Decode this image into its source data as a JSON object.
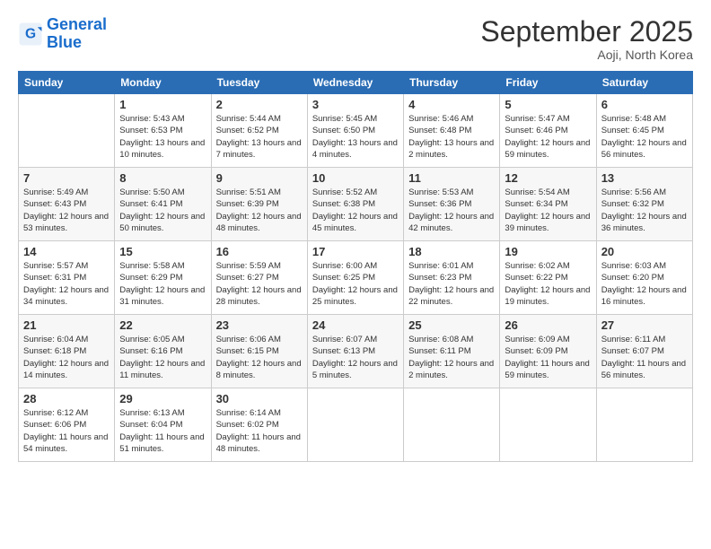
{
  "header": {
    "logo_line1": "General",
    "logo_line2": "Blue",
    "month": "September 2025",
    "location": "Aoji, North Korea"
  },
  "days_of_week": [
    "Sunday",
    "Monday",
    "Tuesday",
    "Wednesday",
    "Thursday",
    "Friday",
    "Saturday"
  ],
  "weeks": [
    [
      {
        "day": "",
        "sunrise": "",
        "sunset": "",
        "daylight": ""
      },
      {
        "day": "1",
        "sunrise": "Sunrise: 5:43 AM",
        "sunset": "Sunset: 6:53 PM",
        "daylight": "Daylight: 13 hours and 10 minutes."
      },
      {
        "day": "2",
        "sunrise": "Sunrise: 5:44 AM",
        "sunset": "Sunset: 6:52 PM",
        "daylight": "Daylight: 13 hours and 7 minutes."
      },
      {
        "day": "3",
        "sunrise": "Sunrise: 5:45 AM",
        "sunset": "Sunset: 6:50 PM",
        "daylight": "Daylight: 13 hours and 4 minutes."
      },
      {
        "day": "4",
        "sunrise": "Sunrise: 5:46 AM",
        "sunset": "Sunset: 6:48 PM",
        "daylight": "Daylight: 13 hours and 2 minutes."
      },
      {
        "day": "5",
        "sunrise": "Sunrise: 5:47 AM",
        "sunset": "Sunset: 6:46 PM",
        "daylight": "Daylight: 12 hours and 59 minutes."
      },
      {
        "day": "6",
        "sunrise": "Sunrise: 5:48 AM",
        "sunset": "Sunset: 6:45 PM",
        "daylight": "Daylight: 12 hours and 56 minutes."
      }
    ],
    [
      {
        "day": "7",
        "sunrise": "Sunrise: 5:49 AM",
        "sunset": "Sunset: 6:43 PM",
        "daylight": "Daylight: 12 hours and 53 minutes."
      },
      {
        "day": "8",
        "sunrise": "Sunrise: 5:50 AM",
        "sunset": "Sunset: 6:41 PM",
        "daylight": "Daylight: 12 hours and 50 minutes."
      },
      {
        "day": "9",
        "sunrise": "Sunrise: 5:51 AM",
        "sunset": "Sunset: 6:39 PM",
        "daylight": "Daylight: 12 hours and 48 minutes."
      },
      {
        "day": "10",
        "sunrise": "Sunrise: 5:52 AM",
        "sunset": "Sunset: 6:38 PM",
        "daylight": "Daylight: 12 hours and 45 minutes."
      },
      {
        "day": "11",
        "sunrise": "Sunrise: 5:53 AM",
        "sunset": "Sunset: 6:36 PM",
        "daylight": "Daylight: 12 hours and 42 minutes."
      },
      {
        "day": "12",
        "sunrise": "Sunrise: 5:54 AM",
        "sunset": "Sunset: 6:34 PM",
        "daylight": "Daylight: 12 hours and 39 minutes."
      },
      {
        "day": "13",
        "sunrise": "Sunrise: 5:56 AM",
        "sunset": "Sunset: 6:32 PM",
        "daylight": "Daylight: 12 hours and 36 minutes."
      }
    ],
    [
      {
        "day": "14",
        "sunrise": "Sunrise: 5:57 AM",
        "sunset": "Sunset: 6:31 PM",
        "daylight": "Daylight: 12 hours and 34 minutes."
      },
      {
        "day": "15",
        "sunrise": "Sunrise: 5:58 AM",
        "sunset": "Sunset: 6:29 PM",
        "daylight": "Daylight: 12 hours and 31 minutes."
      },
      {
        "day": "16",
        "sunrise": "Sunrise: 5:59 AM",
        "sunset": "Sunset: 6:27 PM",
        "daylight": "Daylight: 12 hours and 28 minutes."
      },
      {
        "day": "17",
        "sunrise": "Sunrise: 6:00 AM",
        "sunset": "Sunset: 6:25 PM",
        "daylight": "Daylight: 12 hours and 25 minutes."
      },
      {
        "day": "18",
        "sunrise": "Sunrise: 6:01 AM",
        "sunset": "Sunset: 6:23 PM",
        "daylight": "Daylight: 12 hours and 22 minutes."
      },
      {
        "day": "19",
        "sunrise": "Sunrise: 6:02 AM",
        "sunset": "Sunset: 6:22 PM",
        "daylight": "Daylight: 12 hours and 19 minutes."
      },
      {
        "day": "20",
        "sunrise": "Sunrise: 6:03 AM",
        "sunset": "Sunset: 6:20 PM",
        "daylight": "Daylight: 12 hours and 16 minutes."
      }
    ],
    [
      {
        "day": "21",
        "sunrise": "Sunrise: 6:04 AM",
        "sunset": "Sunset: 6:18 PM",
        "daylight": "Daylight: 12 hours and 14 minutes."
      },
      {
        "day": "22",
        "sunrise": "Sunrise: 6:05 AM",
        "sunset": "Sunset: 6:16 PM",
        "daylight": "Daylight: 12 hours and 11 minutes."
      },
      {
        "day": "23",
        "sunrise": "Sunrise: 6:06 AM",
        "sunset": "Sunset: 6:15 PM",
        "daylight": "Daylight: 12 hours and 8 minutes."
      },
      {
        "day": "24",
        "sunrise": "Sunrise: 6:07 AM",
        "sunset": "Sunset: 6:13 PM",
        "daylight": "Daylight: 12 hours and 5 minutes."
      },
      {
        "day": "25",
        "sunrise": "Sunrise: 6:08 AM",
        "sunset": "Sunset: 6:11 PM",
        "daylight": "Daylight: 12 hours and 2 minutes."
      },
      {
        "day": "26",
        "sunrise": "Sunrise: 6:09 AM",
        "sunset": "Sunset: 6:09 PM",
        "daylight": "Daylight: 11 hours and 59 minutes."
      },
      {
        "day": "27",
        "sunrise": "Sunrise: 6:11 AM",
        "sunset": "Sunset: 6:07 PM",
        "daylight": "Daylight: 11 hours and 56 minutes."
      }
    ],
    [
      {
        "day": "28",
        "sunrise": "Sunrise: 6:12 AM",
        "sunset": "Sunset: 6:06 PM",
        "daylight": "Daylight: 11 hours and 54 minutes."
      },
      {
        "day": "29",
        "sunrise": "Sunrise: 6:13 AM",
        "sunset": "Sunset: 6:04 PM",
        "daylight": "Daylight: 11 hours and 51 minutes."
      },
      {
        "day": "30",
        "sunrise": "Sunrise: 6:14 AM",
        "sunset": "Sunset: 6:02 PM",
        "daylight": "Daylight: 11 hours and 48 minutes."
      },
      {
        "day": "",
        "sunrise": "",
        "sunset": "",
        "daylight": ""
      },
      {
        "day": "",
        "sunrise": "",
        "sunset": "",
        "daylight": ""
      },
      {
        "day": "",
        "sunrise": "",
        "sunset": "",
        "daylight": ""
      },
      {
        "day": "",
        "sunrise": "",
        "sunset": "",
        "daylight": ""
      }
    ]
  ]
}
